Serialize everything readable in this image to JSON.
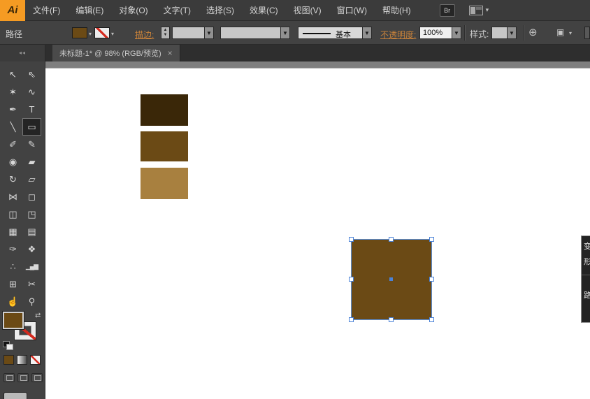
{
  "menu": {
    "logo": "Ai",
    "items": [
      "文件(F)",
      "编辑(E)",
      "对象(O)",
      "文字(T)",
      "选择(S)",
      "效果(C)",
      "视图(V)",
      "窗口(W)",
      "帮助(H)"
    ],
    "bridge_badge": "Br"
  },
  "control_bar": {
    "selection_type": "路径",
    "stroke_link": "描边:",
    "stroke_style": "基本",
    "opacity_link": "不透明度:",
    "opacity_value": "100%",
    "style_label": "样式:",
    "fill_color": "#6b4a15",
    "stroke_value": "none"
  },
  "document_tab": {
    "title": "未标题-1* @ 98% (RGB/预览)",
    "close": "×"
  },
  "toolbar": {
    "collapse_glyph": "◂◂",
    "fill_color": "#6b4a15",
    "stroke": "none",
    "swap_glyph": "⇄",
    "tools": [
      {
        "name": "selection",
        "glyph": "↖"
      },
      {
        "name": "direct-selection",
        "glyph": "⇖"
      },
      {
        "name": "magic-wand",
        "glyph": "✶"
      },
      {
        "name": "lasso",
        "glyph": "∿"
      },
      {
        "name": "pen",
        "glyph": "✒"
      },
      {
        "name": "type",
        "glyph": "T"
      },
      {
        "name": "line-segment",
        "glyph": "╲"
      },
      {
        "name": "rectangle",
        "glyph": "▭",
        "selected": true
      },
      {
        "name": "paintbrush",
        "glyph": "✐"
      },
      {
        "name": "pencil",
        "glyph": "✎"
      },
      {
        "name": "blob-brush",
        "glyph": "◉"
      },
      {
        "name": "eraser",
        "glyph": "▰"
      },
      {
        "name": "rotate",
        "glyph": "↻"
      },
      {
        "name": "scale",
        "glyph": "▱"
      },
      {
        "name": "width",
        "glyph": "⋈"
      },
      {
        "name": "free-transform",
        "glyph": "◻"
      },
      {
        "name": "shape-builder",
        "glyph": "◫"
      },
      {
        "name": "perspective-grid",
        "glyph": "◳"
      },
      {
        "name": "mesh",
        "glyph": "▦"
      },
      {
        "name": "gradient",
        "glyph": "▤"
      },
      {
        "name": "eyedropper",
        "glyph": "✑"
      },
      {
        "name": "blend",
        "glyph": "❖"
      },
      {
        "name": "symbol-sprayer",
        "glyph": "∴"
      },
      {
        "name": "column-graph",
        "glyph": "▁▄▆"
      },
      {
        "name": "artboard",
        "glyph": "⊞"
      },
      {
        "name": "slice",
        "glyph": "✂"
      },
      {
        "name": "hand",
        "glyph": "☝"
      },
      {
        "name": "zoom",
        "glyph": "⚲"
      }
    ]
  },
  "canvas": {
    "swatches": [
      {
        "color": "#3a2708"
      },
      {
        "color": "#6b4a15"
      },
      {
        "color": "#a8803f"
      }
    ],
    "selected_object": {
      "color": "#6b4a15"
    }
  },
  "right_dock": {
    "labels": [
      "变",
      "形",
      "路"
    ]
  },
  "colors": {
    "selection_blue": "#4a82d8",
    "link_orange": "#c8823a",
    "logo_amber": "#F59B23",
    "pasteboard_gray": "#7f7f7f"
  }
}
